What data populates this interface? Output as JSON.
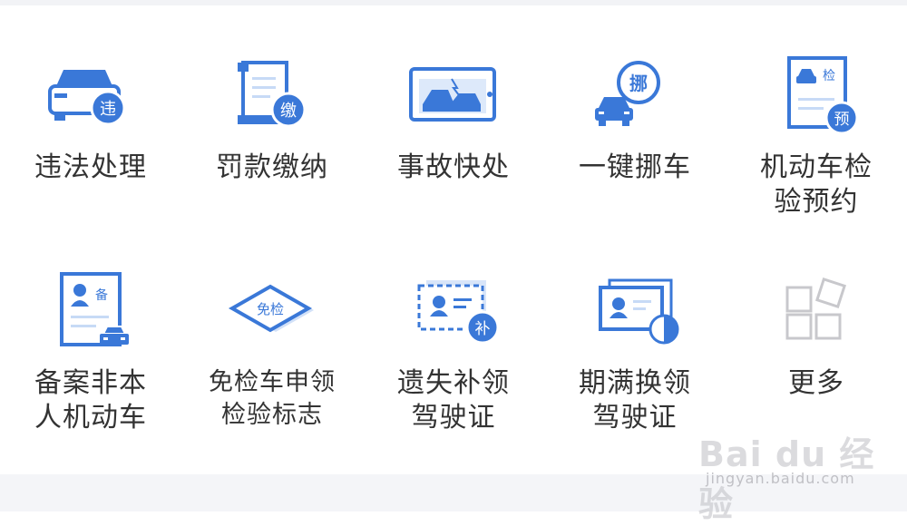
{
  "services": [
    {
      "label": "违法处理",
      "icon": "car-violation-icon",
      "badge": "违"
    },
    {
      "label": "罚款缴纳",
      "icon": "fine-payment-document-icon",
      "badge": "缴"
    },
    {
      "label": "事故快处",
      "icon": "accident-photo-icon",
      "badge": ""
    },
    {
      "label": "一键挪车",
      "icon": "move-car-icon",
      "badge": "挪"
    },
    {
      "label": "机动车检验预约",
      "icon": "vehicle-inspection-appointment-icon",
      "badge": "预",
      "tag": "检"
    },
    {
      "label": "备案非本人机动车",
      "icon": "vehicle-registration-record-icon",
      "tag": "备"
    },
    {
      "label": "免检车申领检验标志",
      "icon": "inspection-exempt-sticker-icon",
      "tag": "免检"
    },
    {
      "label": "遗失补领驾驶证",
      "icon": "lost-license-reissue-icon",
      "badge": "补"
    },
    {
      "label": "期满换领驾驶证",
      "icon": "license-renewal-icon",
      "badge": ""
    },
    {
      "label": "更多",
      "icon": "more-grid-icon",
      "badge": ""
    }
  ],
  "labels_wrapped": [
    [
      "违法处理"
    ],
    [
      "罚款缴纳"
    ],
    [
      "事故快处"
    ],
    [
      "一键挪车"
    ],
    [
      "机动车检",
      "验预约"
    ],
    [
      "备案非本",
      "人机动车"
    ],
    [
      "免检车申领",
      "检验标志"
    ],
    [
      "遗失补领",
      "驾驶证"
    ],
    [
      "期满换领",
      "驾驶证"
    ],
    [
      "更多"
    ]
  ],
  "watermark": {
    "logo": "Bai du 经验",
    "url": "jingyan.baidu.com"
  },
  "colors": {
    "primary": "#3a78d8",
    "light": "#c7daf6",
    "text": "#333333",
    "more": "#c8c8cc"
  }
}
